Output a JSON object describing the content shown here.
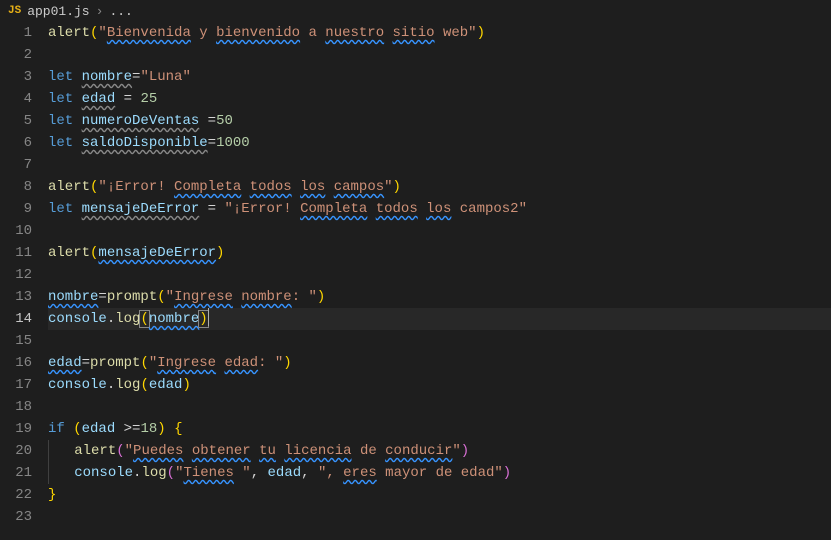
{
  "tab": {
    "icon_label": "JS",
    "filename": "app01.js",
    "crumb_dots": "..."
  },
  "lines": {
    "count": 23,
    "active": 14
  },
  "code": {
    "l1": {
      "fn": "alert",
      "str_bienvenida": "Bienvenida",
      "y": "y",
      "bienvenido": "bienvenido",
      "a": "a",
      "nuestro": "nuestro",
      "sitio": "sitio",
      "web": "web"
    },
    "l3": {
      "kw": "let",
      "var": "nombre",
      "val": "\"Luna\""
    },
    "l4": {
      "kw": "let",
      "var": "edad",
      "val": "25"
    },
    "l5": {
      "kw": "let",
      "var": "numeroDeVentas",
      "val": "50"
    },
    "l6": {
      "kw": "let",
      "var": "saldoDisponible",
      "val": "1000"
    },
    "l8": {
      "fn": "alert",
      "s1": "¡Error!",
      "s2": "Completa",
      "s3": "todos",
      "s4": "los",
      "s5": "campos"
    },
    "l9": {
      "kw": "let",
      "var": "mensajeDeError",
      "s1": "¡Error!",
      "s2": "Completa",
      "s3": "todos",
      "s4": "los",
      "s5": "campos2"
    },
    "l11": {
      "fn": "alert",
      "arg": "mensajeDeError"
    },
    "l13": {
      "var": "nombre",
      "fn": "prompt",
      "s1": "Ingrese",
      "s2": "nombre",
      "s3": ": "
    },
    "l14": {
      "obj": "console",
      "fn": "log",
      "arg": "nombre"
    },
    "l16": {
      "var": "edad",
      "fn": "prompt",
      "s1": "Ingrese",
      "s2": "edad",
      "s3": ": "
    },
    "l17": {
      "obj": "console",
      "fn": "log",
      "arg": "edad"
    },
    "l19": {
      "kw": "if",
      "var": "edad",
      "op": ">=",
      "val": "18"
    },
    "l20": {
      "fn": "alert",
      "s1": "Puedes",
      "s2": "obtener",
      "s3": "tu",
      "s4": "licencia",
      "s5": "de",
      "s6": "conducir"
    },
    "l21": {
      "obj": "console",
      "fn": "log",
      "s1": "Tienes",
      "v1": "edad",
      "sep": ", ",
      "s2": "eres",
      "s3": "mayor de edad"
    }
  }
}
